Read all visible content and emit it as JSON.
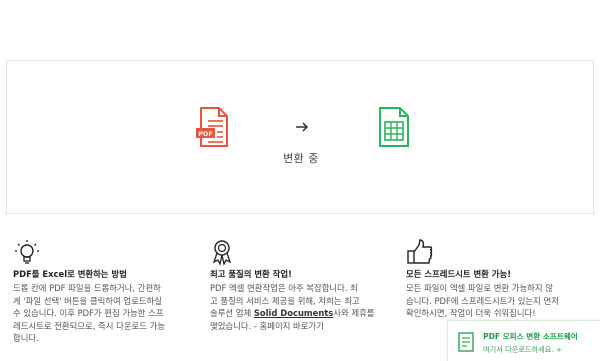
{
  "converter": {
    "status": "변환 중",
    "icons": [
      "pdf-file-icon",
      "arrow-right-icon",
      "spreadsheet-file-icon"
    ],
    "pdf_badge": "PDF",
    "pdf_color": "#e8553a",
    "sheet_color": "#2ab55a"
  },
  "features": [
    {
      "icon": "lightbulb-icon",
      "title": "PDF를 Excel로 변환하는 방법",
      "lines": [
        "드롭 칸에 PDF 파일을 드롭하거나, 간편하",
        "게 '파일 선택' 버튼을 클릭하여 업로드하실",
        "수 있습니다. 이후 PDF가 편집 가능한 스프",
        "레드시트로 전환되므로, 즉시 다운로드 가능",
        "합니다."
      ]
    },
    {
      "icon": "award-ribbon-icon",
      "title": "최고 품질의 변환 작업!",
      "lines": [
        "PDF 엑셀 변환작업은 아주 복잡합니다. 최",
        "고 품질의 서비스 제공을 위해, 저희는 최고",
        "솔루션 업체 ",
        "Solid Documents",
        "사와 제휴를",
        "맺었습니다. - 홈페이지 바로가기"
      ]
    },
    {
      "icon": "thumbs-up-icon",
      "title": "모든 스프레드시트 변환 가능!",
      "lines": [
        "모든 파일이 엑셀 파일로 변환 가능하지 않",
        "습니다. PDF에 스프레드시트가 있는지 먼저",
        "확인하시면, 작업이 더욱 쉬워집니다!"
      ]
    }
  ],
  "promo": {
    "icon": "pdf-software-icon",
    "title": "PDF 오피스 변환 소프트웨어",
    "subtitle": "여기서 다운로드하세요. +"
  }
}
